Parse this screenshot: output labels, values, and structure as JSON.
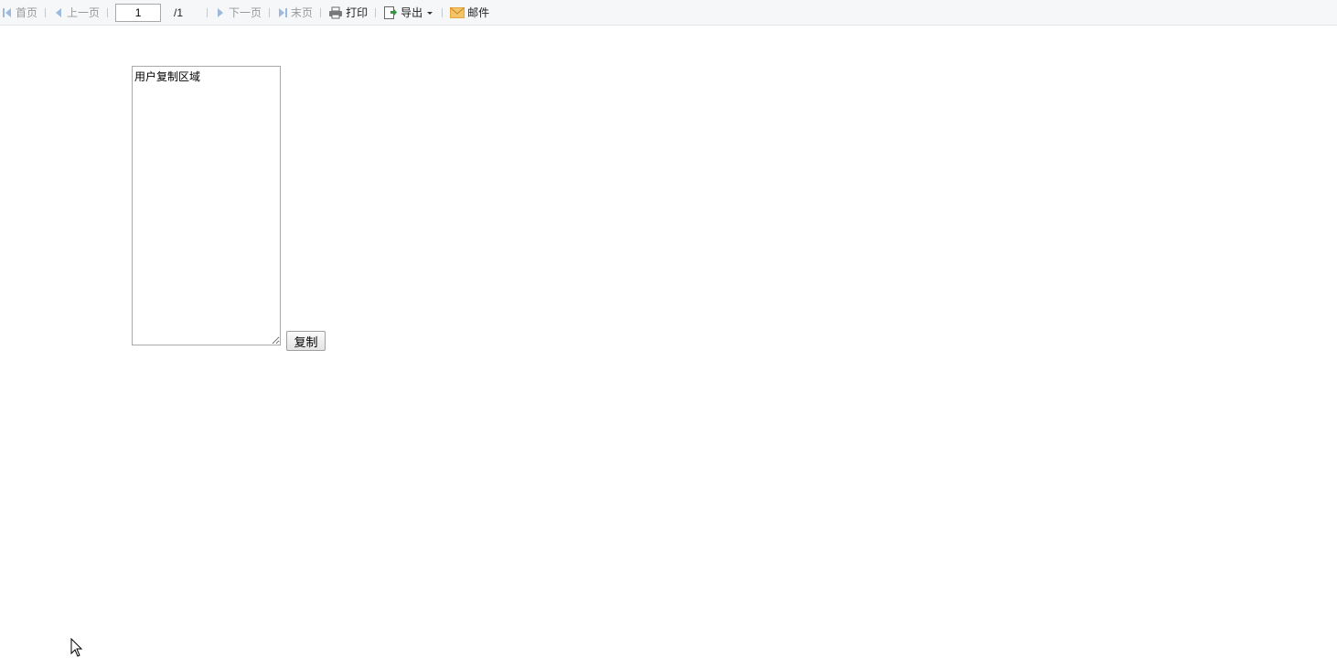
{
  "toolbar": {
    "first": "首页",
    "prev": "上一页",
    "page_value": "1",
    "page_total": "/1",
    "next": "下一页",
    "last": "末页",
    "print": "打印",
    "export": "导出",
    "mail": "邮件"
  },
  "main": {
    "textarea_value": "用户复制区域",
    "copy_button": "复制"
  },
  "colors": {
    "disabled_arrow": "#9db9dc",
    "export_green": "#2e9a3c",
    "mail_orange": "#e9a53c"
  }
}
